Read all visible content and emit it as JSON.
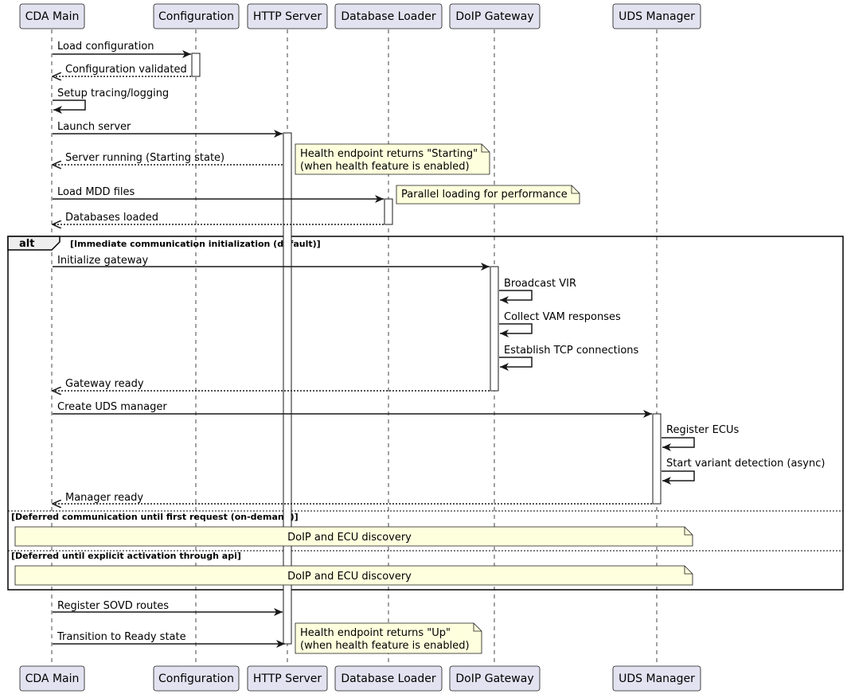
{
  "participants": [
    {
      "id": "cda",
      "label": "CDA Main"
    },
    {
      "id": "config",
      "label": "Configuration"
    },
    {
      "id": "http",
      "label": "HTTP Server"
    },
    {
      "id": "db",
      "label": "Database Loader"
    },
    {
      "id": "doip",
      "label": "DoIP Gateway"
    },
    {
      "id": "uds",
      "label": "UDS Manager"
    }
  ],
  "messages": [
    {
      "id": "m1",
      "label": "Load configuration",
      "from": "cda",
      "to": "config",
      "style": "solid"
    },
    {
      "id": "m2",
      "label": "Configuration validated",
      "from": "config",
      "to": "cda",
      "style": "dotted"
    },
    {
      "id": "m3",
      "label": "Setup tracing/logging",
      "from": "cda",
      "to": "cda",
      "style": "solid"
    },
    {
      "id": "m4",
      "label": "Launch server",
      "from": "cda",
      "to": "http",
      "style": "solid"
    },
    {
      "id": "m5",
      "label": "Server running (Starting state)",
      "from": "http",
      "to": "cda",
      "style": "dotted"
    },
    {
      "id": "m6",
      "label": "Load MDD files",
      "from": "cda",
      "to": "db",
      "style": "solid"
    },
    {
      "id": "m7",
      "label": "Databases loaded",
      "from": "db",
      "to": "cda",
      "style": "dotted"
    },
    {
      "id": "m8",
      "label": "Initialize gateway",
      "from": "cda",
      "to": "doip",
      "style": "solid"
    },
    {
      "id": "m9",
      "label": "Broadcast VIR",
      "from": "doip",
      "to": "doip",
      "style": "solid"
    },
    {
      "id": "m10",
      "label": "Collect VAM responses",
      "from": "doip",
      "to": "doip",
      "style": "solid"
    },
    {
      "id": "m11",
      "label": "Establish TCP connections",
      "from": "doip",
      "to": "doip",
      "style": "solid"
    },
    {
      "id": "m12",
      "label": "Gateway ready",
      "from": "doip",
      "to": "cda",
      "style": "dotted"
    },
    {
      "id": "m13",
      "label": "Create UDS manager",
      "from": "cda",
      "to": "uds",
      "style": "solid"
    },
    {
      "id": "m14",
      "label": "Register ECUs",
      "from": "uds",
      "to": "uds",
      "style": "solid"
    },
    {
      "id": "m15",
      "label": "Start variant detection (async)",
      "from": "uds",
      "to": "uds",
      "style": "solid"
    },
    {
      "id": "m16",
      "label": "Manager ready",
      "from": "uds",
      "to": "cda",
      "style": "dotted"
    },
    {
      "id": "m17",
      "label": "Register SOVD routes",
      "from": "cda",
      "to": "http",
      "style": "solid"
    },
    {
      "id": "m18",
      "label": "Transition to Ready state",
      "from": "cda",
      "to": "http",
      "style": "solid"
    }
  ],
  "notes": [
    {
      "id": "n1",
      "lines": [
        "Health endpoint returns \"Starting\"",
        "(when health feature is enabled)"
      ]
    },
    {
      "id": "n2",
      "lines": [
        "Parallel loading for performance"
      ]
    },
    {
      "id": "n3",
      "lines": [
        "DoIP and ECU discovery"
      ]
    },
    {
      "id": "n4",
      "lines": [
        "DoIP and ECU discovery"
      ]
    },
    {
      "id": "n5",
      "lines": [
        "Health endpoint returns \"Up\"",
        "(when health feature is enabled)"
      ]
    }
  ],
  "alt_frame": {
    "keyword": "alt",
    "guards": [
      "[Immediate communication initialization (default)]",
      "[Deferred communication until first request (on-demand)]",
      "[Deferred until explicit activation through api]"
    ]
  },
  "colors": {
    "participant_fill": "#E2E2F0",
    "participant_stroke": "#181818",
    "note_fill": "#FEFFDD",
    "note_stroke": "#181818",
    "activation_fill": "#FFFFFF",
    "frame_label_fill": "#EEEEEE",
    "line": "#181818"
  }
}
